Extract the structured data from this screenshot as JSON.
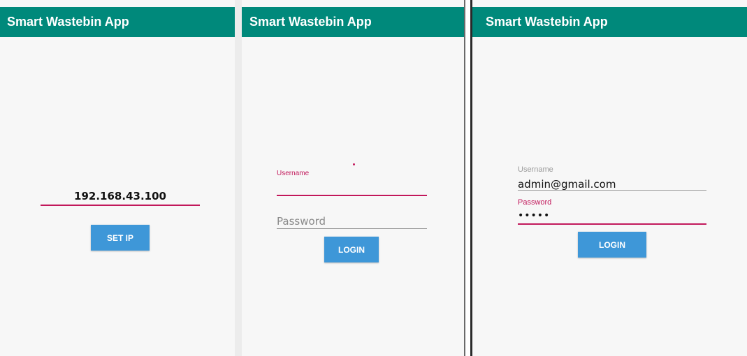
{
  "app": {
    "title": "Smart Wastebin App"
  },
  "colors": {
    "appbar": "#00897b",
    "button": "#3e97d8",
    "accent": "#c2185b",
    "inactive_line": "#999999"
  },
  "screen_ip": {
    "ip_value": "192.168.43.100",
    "set_ip_label": "SET IP"
  },
  "screen_login_empty": {
    "username_label": "Username",
    "password_placeholder": "Password",
    "login_label": "LOGIN"
  },
  "screen_login_filled": {
    "username_label": "Username",
    "username_value": "admin@gmail.com",
    "password_label": "Password",
    "password_value": "•••••",
    "login_label": "LOGIN"
  }
}
